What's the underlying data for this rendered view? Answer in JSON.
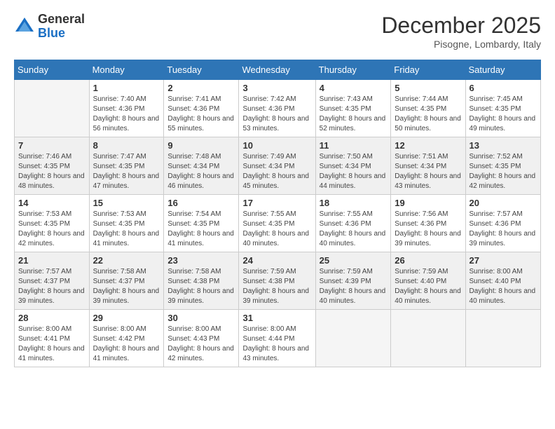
{
  "logo": {
    "general": "General",
    "blue": "Blue"
  },
  "title": "December 2025",
  "location": "Pisogne, Lombardy, Italy",
  "weekdays": [
    "Sunday",
    "Monday",
    "Tuesday",
    "Wednesday",
    "Thursday",
    "Friday",
    "Saturday"
  ],
  "weeks": [
    [
      {
        "day": "",
        "sunrise": "",
        "sunset": "",
        "daylight": ""
      },
      {
        "day": "1",
        "sunrise": "Sunrise: 7:40 AM",
        "sunset": "Sunset: 4:36 PM",
        "daylight": "Daylight: 8 hours and 56 minutes."
      },
      {
        "day": "2",
        "sunrise": "Sunrise: 7:41 AM",
        "sunset": "Sunset: 4:36 PM",
        "daylight": "Daylight: 8 hours and 55 minutes."
      },
      {
        "day": "3",
        "sunrise": "Sunrise: 7:42 AM",
        "sunset": "Sunset: 4:36 PM",
        "daylight": "Daylight: 8 hours and 53 minutes."
      },
      {
        "day": "4",
        "sunrise": "Sunrise: 7:43 AM",
        "sunset": "Sunset: 4:35 PM",
        "daylight": "Daylight: 8 hours and 52 minutes."
      },
      {
        "day": "5",
        "sunrise": "Sunrise: 7:44 AM",
        "sunset": "Sunset: 4:35 PM",
        "daylight": "Daylight: 8 hours and 50 minutes."
      },
      {
        "day": "6",
        "sunrise": "Sunrise: 7:45 AM",
        "sunset": "Sunset: 4:35 PM",
        "daylight": "Daylight: 8 hours and 49 minutes."
      }
    ],
    [
      {
        "day": "7",
        "sunrise": "Sunrise: 7:46 AM",
        "sunset": "Sunset: 4:35 PM",
        "daylight": "Daylight: 8 hours and 48 minutes."
      },
      {
        "day": "8",
        "sunrise": "Sunrise: 7:47 AM",
        "sunset": "Sunset: 4:35 PM",
        "daylight": "Daylight: 8 hours and 47 minutes."
      },
      {
        "day": "9",
        "sunrise": "Sunrise: 7:48 AM",
        "sunset": "Sunset: 4:34 PM",
        "daylight": "Daylight: 8 hours and 46 minutes."
      },
      {
        "day": "10",
        "sunrise": "Sunrise: 7:49 AM",
        "sunset": "Sunset: 4:34 PM",
        "daylight": "Daylight: 8 hours and 45 minutes."
      },
      {
        "day": "11",
        "sunrise": "Sunrise: 7:50 AM",
        "sunset": "Sunset: 4:34 PM",
        "daylight": "Daylight: 8 hours and 44 minutes."
      },
      {
        "day": "12",
        "sunrise": "Sunrise: 7:51 AM",
        "sunset": "Sunset: 4:34 PM",
        "daylight": "Daylight: 8 hours and 43 minutes."
      },
      {
        "day": "13",
        "sunrise": "Sunrise: 7:52 AM",
        "sunset": "Sunset: 4:35 PM",
        "daylight": "Daylight: 8 hours and 42 minutes."
      }
    ],
    [
      {
        "day": "14",
        "sunrise": "Sunrise: 7:53 AM",
        "sunset": "Sunset: 4:35 PM",
        "daylight": "Daylight: 8 hours and 42 minutes."
      },
      {
        "day": "15",
        "sunrise": "Sunrise: 7:53 AM",
        "sunset": "Sunset: 4:35 PM",
        "daylight": "Daylight: 8 hours and 41 minutes."
      },
      {
        "day": "16",
        "sunrise": "Sunrise: 7:54 AM",
        "sunset": "Sunset: 4:35 PM",
        "daylight": "Daylight: 8 hours and 41 minutes."
      },
      {
        "day": "17",
        "sunrise": "Sunrise: 7:55 AM",
        "sunset": "Sunset: 4:35 PM",
        "daylight": "Daylight: 8 hours and 40 minutes."
      },
      {
        "day": "18",
        "sunrise": "Sunrise: 7:55 AM",
        "sunset": "Sunset: 4:36 PM",
        "daylight": "Daylight: 8 hours and 40 minutes."
      },
      {
        "day": "19",
        "sunrise": "Sunrise: 7:56 AM",
        "sunset": "Sunset: 4:36 PM",
        "daylight": "Daylight: 8 hours and 39 minutes."
      },
      {
        "day": "20",
        "sunrise": "Sunrise: 7:57 AM",
        "sunset": "Sunset: 4:36 PM",
        "daylight": "Daylight: 8 hours and 39 minutes."
      }
    ],
    [
      {
        "day": "21",
        "sunrise": "Sunrise: 7:57 AM",
        "sunset": "Sunset: 4:37 PM",
        "daylight": "Daylight: 8 hours and 39 minutes."
      },
      {
        "day": "22",
        "sunrise": "Sunrise: 7:58 AM",
        "sunset": "Sunset: 4:37 PM",
        "daylight": "Daylight: 8 hours and 39 minutes."
      },
      {
        "day": "23",
        "sunrise": "Sunrise: 7:58 AM",
        "sunset": "Sunset: 4:38 PM",
        "daylight": "Daylight: 8 hours and 39 minutes."
      },
      {
        "day": "24",
        "sunrise": "Sunrise: 7:59 AM",
        "sunset": "Sunset: 4:38 PM",
        "daylight": "Daylight: 8 hours and 39 minutes."
      },
      {
        "day": "25",
        "sunrise": "Sunrise: 7:59 AM",
        "sunset": "Sunset: 4:39 PM",
        "daylight": "Daylight: 8 hours and 40 minutes."
      },
      {
        "day": "26",
        "sunrise": "Sunrise: 7:59 AM",
        "sunset": "Sunset: 4:40 PM",
        "daylight": "Daylight: 8 hours and 40 minutes."
      },
      {
        "day": "27",
        "sunrise": "Sunrise: 8:00 AM",
        "sunset": "Sunset: 4:40 PM",
        "daylight": "Daylight: 8 hours and 40 minutes."
      }
    ],
    [
      {
        "day": "28",
        "sunrise": "Sunrise: 8:00 AM",
        "sunset": "Sunset: 4:41 PM",
        "daylight": "Daylight: 8 hours and 41 minutes."
      },
      {
        "day": "29",
        "sunrise": "Sunrise: 8:00 AM",
        "sunset": "Sunset: 4:42 PM",
        "daylight": "Daylight: 8 hours and 41 minutes."
      },
      {
        "day": "30",
        "sunrise": "Sunrise: 8:00 AM",
        "sunset": "Sunset: 4:43 PM",
        "daylight": "Daylight: 8 hours and 42 minutes."
      },
      {
        "day": "31",
        "sunrise": "Sunrise: 8:00 AM",
        "sunset": "Sunset: 4:44 PM",
        "daylight": "Daylight: 8 hours and 43 minutes."
      },
      {
        "day": "",
        "sunrise": "",
        "sunset": "",
        "daylight": ""
      },
      {
        "day": "",
        "sunrise": "",
        "sunset": "",
        "daylight": ""
      },
      {
        "day": "",
        "sunrise": "",
        "sunset": "",
        "daylight": ""
      }
    ]
  ]
}
